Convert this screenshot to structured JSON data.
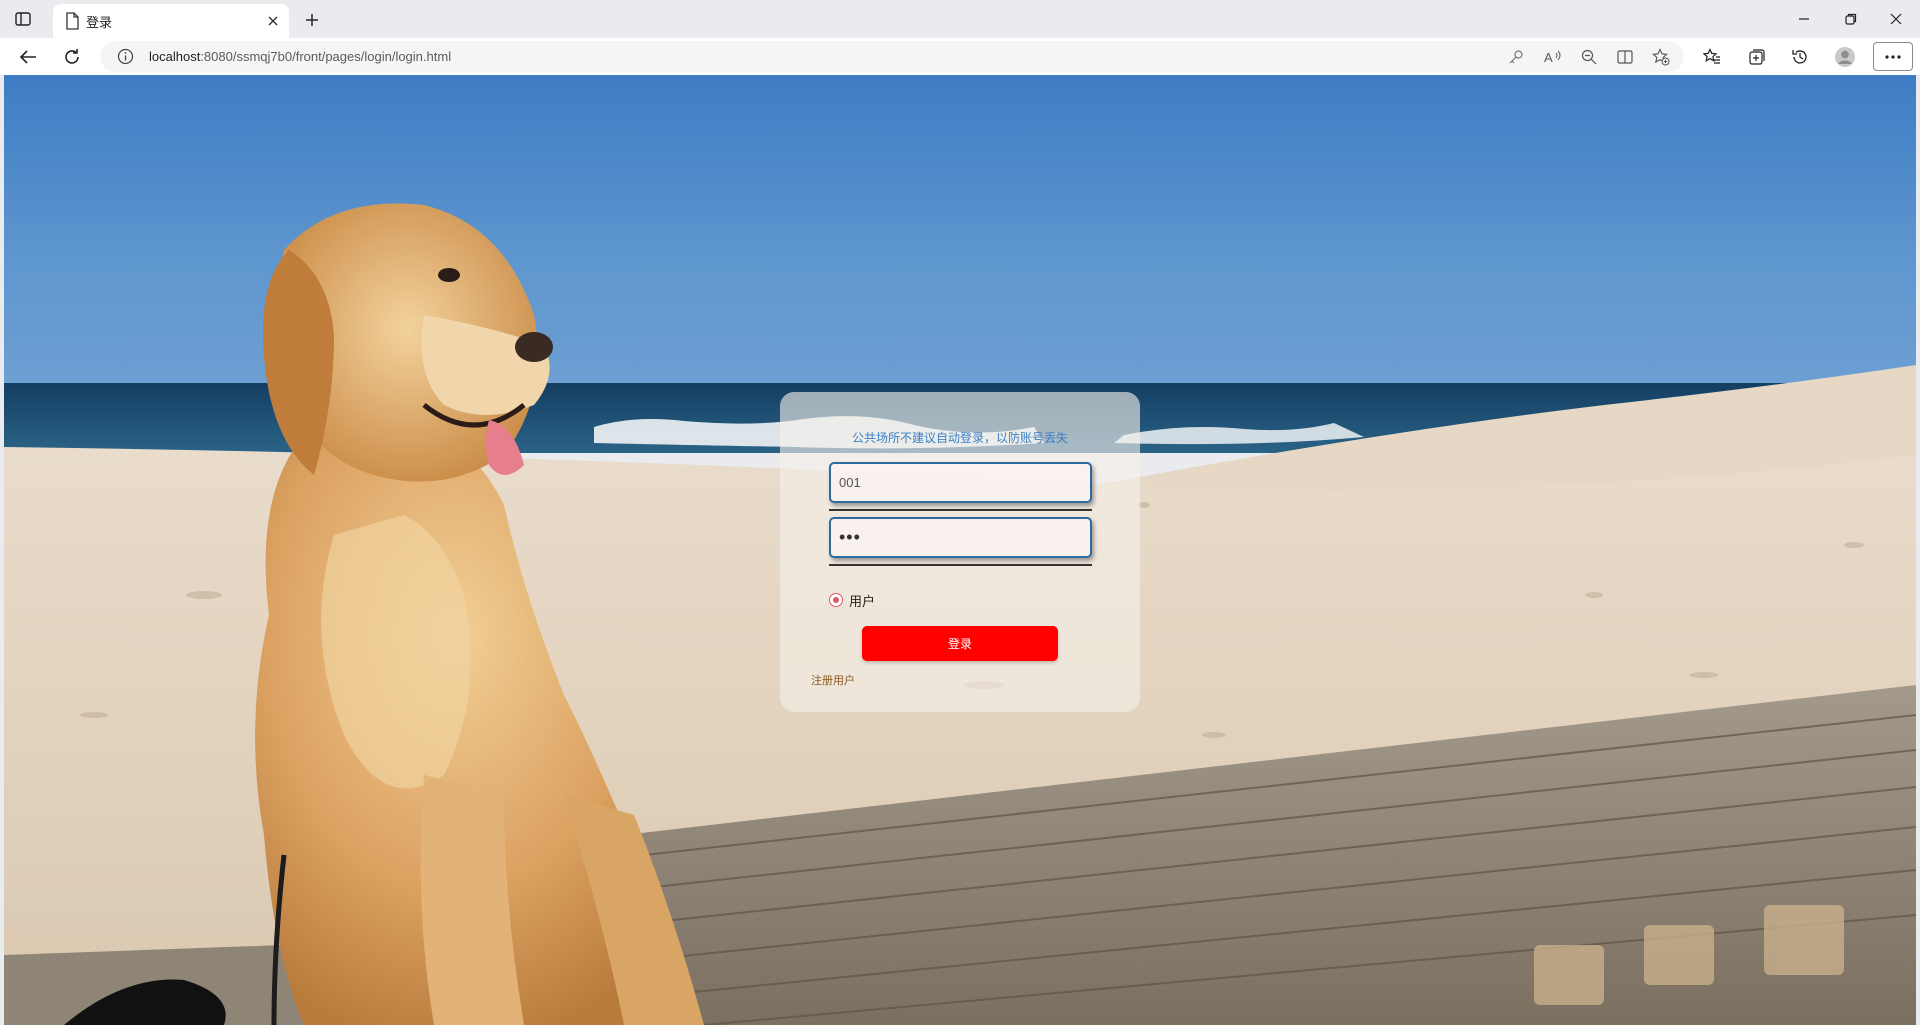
{
  "browser": {
    "tab_title": "登录",
    "address": {
      "host": "localhost",
      "path": ":8080/ssmqj7b0/front/pages/login/login.html"
    },
    "icons": [
      "sidebar-toggle-icon",
      "page-icon",
      "close-icon",
      "plus-icon",
      "minimize-icon",
      "restore-icon",
      "close-window-icon",
      "back-arrow-icon",
      "refresh-icon",
      "info-icon",
      "key-icon",
      "read-aloud-icon",
      "zoom-out-icon",
      "split-screen-icon",
      "add-favorite-icon",
      "favorites-icon",
      "collections-icon",
      "history-icon",
      "profile-icon",
      "more-icon"
    ]
  },
  "login": {
    "tip": "公共场所不建议自动登录，以防账号丢失",
    "username_value": "001",
    "password_value": "•••",
    "role_label": "用户",
    "login_button": "登录",
    "register_link": "注册用户"
  },
  "colors": {
    "login_button": "#ff0000",
    "tip_text": "#3b7fc4",
    "field_border": "#2d6aa0",
    "radio_accent": "#e25b63"
  }
}
